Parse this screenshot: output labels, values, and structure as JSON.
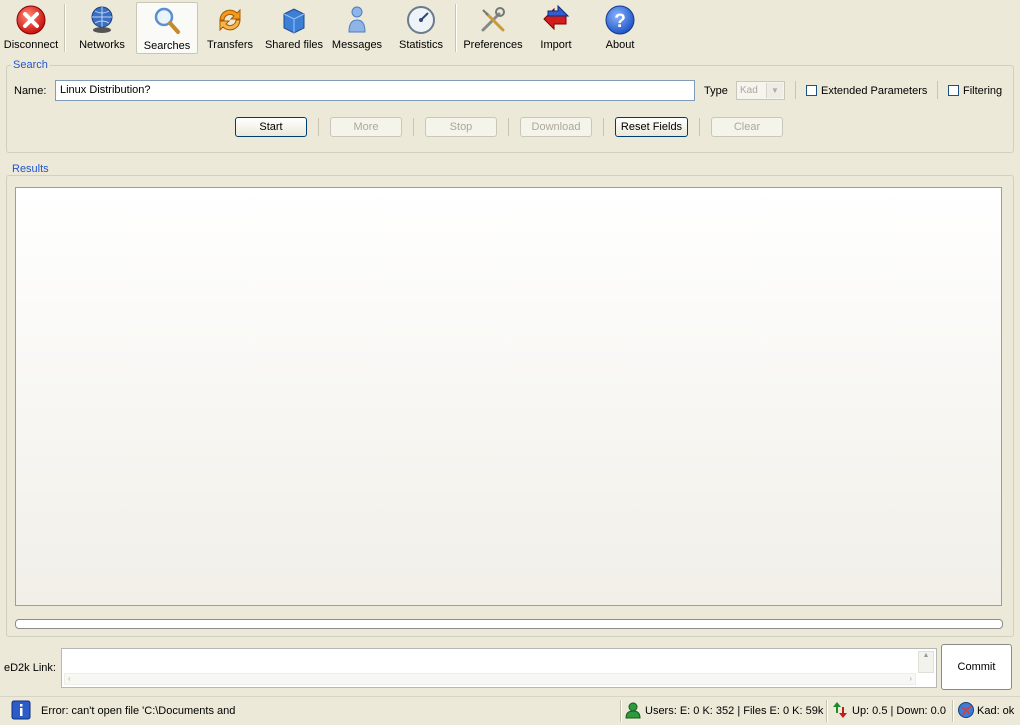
{
  "toolbar": {
    "items": [
      {
        "label": "Disconnect",
        "icon": "disconnect-icon"
      },
      {
        "label": "Networks",
        "icon": "networks-icon"
      },
      {
        "label": "Searches",
        "icon": "searches-icon",
        "active": true
      },
      {
        "label": "Transfers",
        "icon": "transfers-icon"
      },
      {
        "label": "Shared files",
        "icon": "shared-files-icon"
      },
      {
        "label": "Messages",
        "icon": "messages-icon"
      },
      {
        "label": "Statistics",
        "icon": "statistics-icon"
      },
      {
        "label": "Preferences",
        "icon": "preferences-icon"
      },
      {
        "label": "Import",
        "icon": "import-icon"
      },
      {
        "label": "About",
        "icon": "about-icon"
      }
    ]
  },
  "search": {
    "group_title": "Search",
    "name_label": "Name:",
    "name_value": "Linux Distribution?",
    "type_label": "Type",
    "type_value": "Kad",
    "extended_label": "Extended Parameters",
    "filtering_label": "Filtering",
    "buttons": {
      "start": "Start",
      "more": "More",
      "stop": "Stop",
      "download": "Download",
      "reset": "Reset Fields",
      "clear": "Clear"
    }
  },
  "results": {
    "group_title": "Results"
  },
  "ed2k": {
    "label": "eD2k Link:",
    "value": "",
    "commit_label": "Commit"
  },
  "status": {
    "message": "Error: can't open file 'C:\\Documents and",
    "users": "Users: E: 0 K: 352 | Files E: 0 K: 59k",
    "transfer": "Up: 0.5 | Down: 0.0",
    "kad": "Kad: ok"
  },
  "colors": {
    "group_title": "#2255cc",
    "window_bg": "#ece9d8"
  }
}
